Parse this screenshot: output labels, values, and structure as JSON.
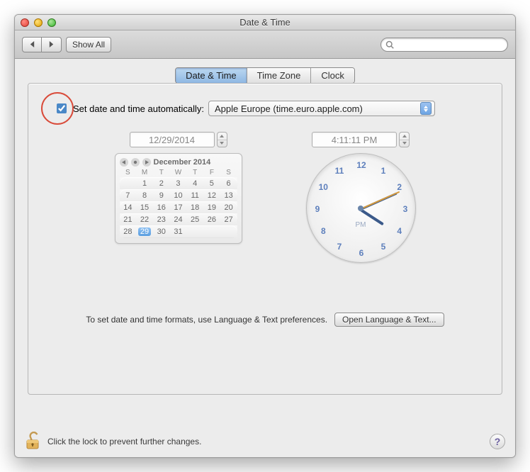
{
  "window": {
    "title": "Date & Time"
  },
  "toolbar": {
    "show_all": "Show All",
    "search_placeholder": ""
  },
  "tabs": {
    "date_time": "Date & Time",
    "time_zone": "Time Zone",
    "clock": "Clock",
    "active": "date_time"
  },
  "auto": {
    "checked": true,
    "label": "Set date and time automatically:",
    "server": "Apple Europe (time.euro.apple.com)"
  },
  "date_field": "12/29/2014",
  "time_field": "4:11:11 PM",
  "calendar": {
    "title": "December 2014",
    "dow": [
      "S",
      "M",
      "T",
      "W",
      "T",
      "F",
      "S"
    ],
    "weeks": [
      [
        "",
        "1",
        "2",
        "3",
        "4",
        "5",
        "6"
      ],
      [
        "7",
        "8",
        "9",
        "10",
        "11",
        "12",
        "13"
      ],
      [
        "14",
        "15",
        "16",
        "17",
        "18",
        "19",
        "20"
      ],
      [
        "21",
        "22",
        "23",
        "24",
        "25",
        "26",
        "27"
      ],
      [
        "28",
        "29",
        "30",
        "31",
        "",
        "",
        ""
      ]
    ],
    "selected": "29"
  },
  "clock": {
    "numbers": [
      "12",
      "1",
      "2",
      "3",
      "4",
      "5",
      "6",
      "7",
      "8",
      "9",
      "10",
      "11"
    ],
    "ampm": "PM",
    "hour_angle": 33,
    "minute_angle": -24,
    "second_angle": -24
  },
  "formats": {
    "text": "To set date and time formats, use Language & Text preferences.",
    "button": "Open Language & Text..."
  },
  "footer": {
    "text": "Click the lock to prevent further changes."
  }
}
